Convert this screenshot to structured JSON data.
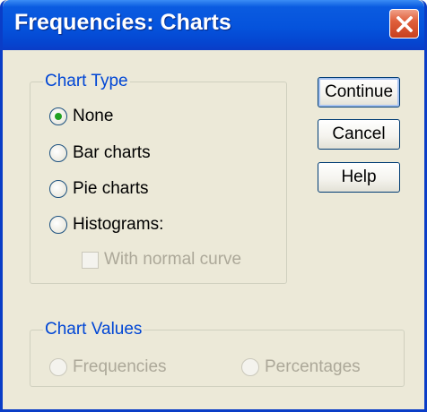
{
  "window": {
    "title": "Frequencies: Charts"
  },
  "chart_type": {
    "label": "Chart Type",
    "options": [
      {
        "label": "None",
        "selected": true
      },
      {
        "label": "Bar charts",
        "selected": false
      },
      {
        "label": "Pie charts",
        "selected": false
      },
      {
        "label": "Histograms:",
        "selected": false
      }
    ],
    "normal_curve": {
      "label": "With normal curve",
      "checked": false,
      "enabled": false
    }
  },
  "chart_values": {
    "label": "Chart Values",
    "options": [
      {
        "label": "Frequencies",
        "enabled": false
      },
      {
        "label": "Percentages",
        "enabled": false
      }
    ]
  },
  "buttons": {
    "continue": "Continue",
    "cancel": "Cancel",
    "help": "Help"
  },
  "colors": {
    "titlebar": "#0553dc",
    "group_label": "#0046d5",
    "selected_radio": "#21a121",
    "dialog_bg": "#ece9d8"
  }
}
